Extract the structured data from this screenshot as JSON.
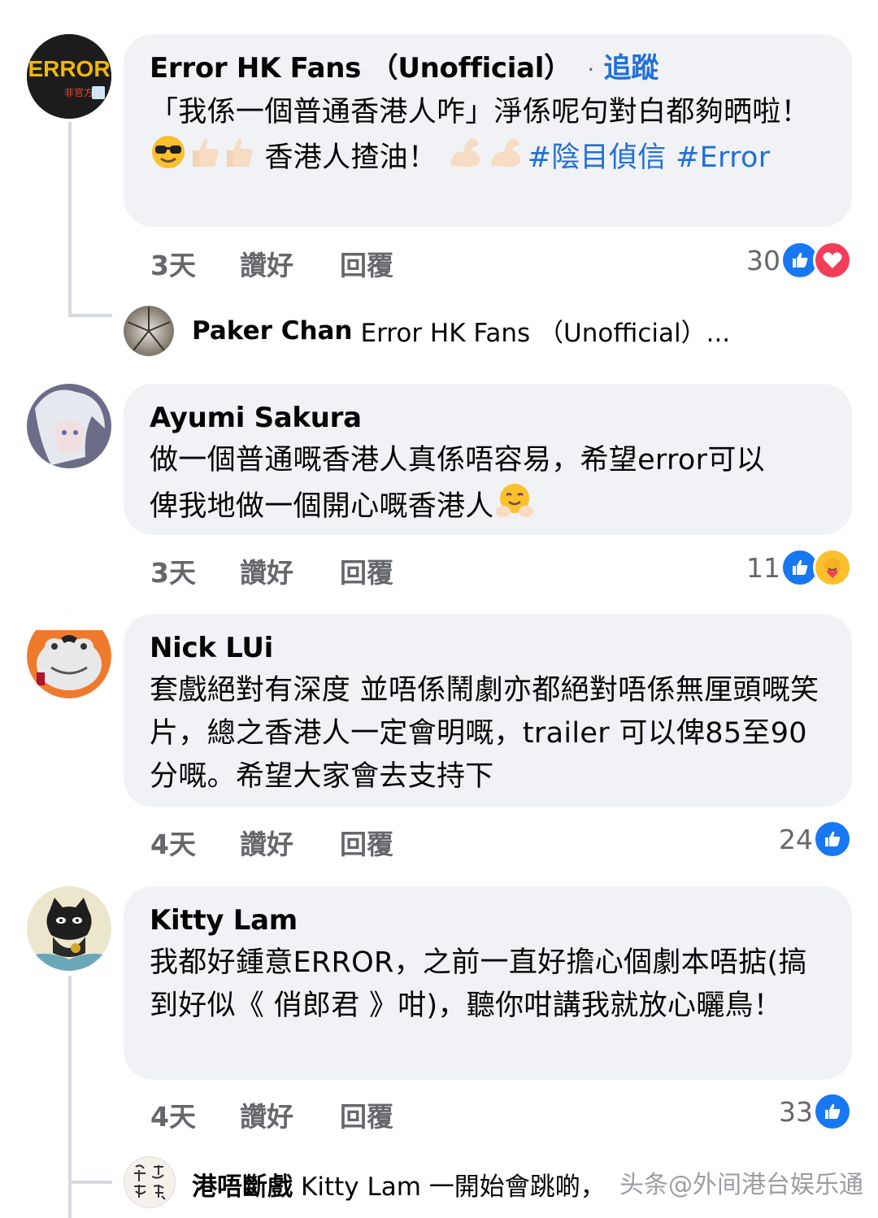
{
  "comments": [
    {
      "name": "Error HK Fans （Unofficial）",
      "follow_separator": "·",
      "follow_label": "追蹤",
      "text_part1": "「我係一個普通香港人咋」淨係呢句對白都夠晒啦！",
      "text_part2": "香港人揸油！",
      "hashtags": [
        "#陰目偵信",
        "#Error"
      ],
      "time": "3天",
      "like_label": "讚好",
      "reply_label": "回覆",
      "reaction_count": "30",
      "avatar_text": "ERROR",
      "avatar_subtext": "非官方"
    },
    {
      "name": "Ayumi Sakura",
      "text": "做一個普通嘅香港人真係唔容易，希望error可以俾我地做一個開心嘅香港人",
      "time": "3天",
      "like_label": "讚好",
      "reply_label": "回覆",
      "reaction_count": "11"
    },
    {
      "name": "Nick LUi",
      "text": "套戲絕對有深度 並唔係鬧劇亦都絕對唔係無厘頭嘅笑片，總之香港人一定會明嘅，trailer 可以俾85至90分嘅。希望大家會去支持下",
      "time": "4天",
      "like_label": "讚好",
      "reply_label": "回覆",
      "reaction_count": "24"
    },
    {
      "name": "Kitty Lam",
      "text": "我都好鍾意ERROR，之前一直好擔心個劇本唔掂(搞到好似《 俏郎君 》咁)，聽你咁講我就放心曬鳥！",
      "time": "4天",
      "like_label": "讚好",
      "reply_label": "回覆",
      "reaction_count": "33"
    }
  ],
  "replies": [
    {
      "name": "Paker Chan",
      "preview": "Error HK Fans （Unofficial）..."
    },
    {
      "name": "港唔斷戲",
      "preview": "Kitty Lam 一開始會跳啲，",
      "avatar_text": "港唔斷戲"
    }
  ],
  "watermark": "头条@外间港台娱乐通",
  "colors": {
    "bubble": "#f0f2f5",
    "link": "#216fdb",
    "meta": "#65676b",
    "like_blue": "#1877f2",
    "love_red": "#f33e58"
  }
}
